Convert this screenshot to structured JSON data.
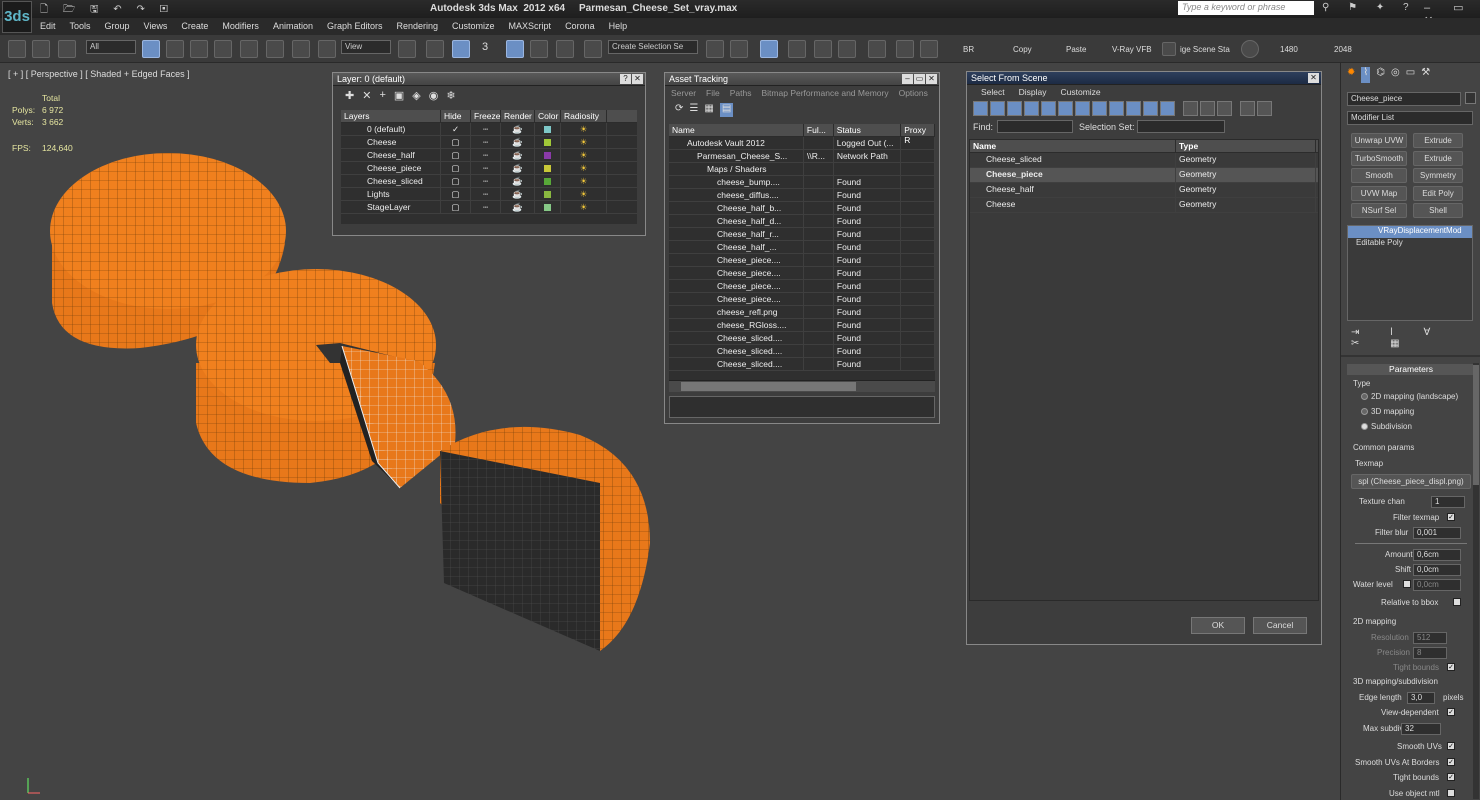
{
  "app": {
    "title": "Autodesk 3ds Max  2012 x64     Parmesan_Cheese_Set_vray.max",
    "logo": "3ds",
    "search_placeholder": "Type a keyword or phrase"
  },
  "menu": [
    "Edit",
    "Tools",
    "Group",
    "Views",
    "Create",
    "Modifiers",
    "Animation",
    "Graph Editors",
    "Rendering",
    "Customize",
    "MAXScript",
    "Corona",
    "Help"
  ],
  "toolbar": {
    "filter": "All",
    "view": "View",
    "selection_set": "Create Selection Se",
    "snap_3": "3",
    "labels": [
      "BR",
      "Copy",
      "Paste",
      "V-Ray VFB",
      "ige Scene Sta",
      "1480",
      "2048"
    ]
  },
  "viewport": {
    "label": "[ + ] [ Perspective ] [ Shaded + Edged Faces ]",
    "stats": {
      "total": "Total",
      "polys_label": "Polys:",
      "polys": "6 972",
      "verts_label": "Verts:",
      "verts": "3 662",
      "fps_label": "FPS:",
      "fps": "124,640"
    }
  },
  "layer_window": {
    "title": "Layer: 0 (default)",
    "columns": [
      "Layers",
      "Hide",
      "Freeze",
      "Render",
      "Color",
      "Radiosity"
    ],
    "rows": [
      {
        "name": "0 (default)",
        "color": "#7ec8c8"
      },
      {
        "name": "Cheese",
        "color": "#a0c838"
      },
      {
        "name": "Cheese_half",
        "color": "#8a3aa8"
      },
      {
        "name": "Cheese_piece",
        "color": "#c8c838"
      },
      {
        "name": "Cheese_sliced",
        "color": "#58a838"
      },
      {
        "name": "Lights",
        "color": "#8ab840"
      },
      {
        "name": "StageLayer",
        "color": "#86c886"
      }
    ]
  },
  "asset_window": {
    "title": "Asset Tracking",
    "menu": [
      "Server",
      "File",
      "Paths",
      "Bitmap Performance and Memory",
      "Options"
    ],
    "columns": [
      "Name",
      "Ful...",
      "Status",
      "Proxy R"
    ],
    "rows": [
      {
        "name": "Autodesk Vault 2012",
        "full": "",
        "status": "Logged Out (...",
        "indent": 1
      },
      {
        "name": "Parmesan_Cheese_S...",
        "full": "\\\\R...",
        "status": "Network Path",
        "indent": 2
      },
      {
        "name": "Maps / Shaders",
        "full": "",
        "status": "",
        "indent": 3
      },
      {
        "name": "cheese_bump....",
        "full": "",
        "status": "Found",
        "indent": 4
      },
      {
        "name": "cheese_diffus....",
        "full": "",
        "status": "Found",
        "indent": 4
      },
      {
        "name": "Cheese_half_b...",
        "full": "",
        "status": "Found",
        "indent": 4
      },
      {
        "name": "Cheese_half_d...",
        "full": "",
        "status": "Found",
        "indent": 4
      },
      {
        "name": "Cheese_half_r...",
        "full": "",
        "status": "Found",
        "indent": 4
      },
      {
        "name": "Cheese_half_...",
        "full": "",
        "status": "Found",
        "indent": 4
      },
      {
        "name": "Cheese_piece....",
        "full": "",
        "status": "Found",
        "indent": 4
      },
      {
        "name": "Cheese_piece....",
        "full": "",
        "status": "Found",
        "indent": 4
      },
      {
        "name": "Cheese_piece....",
        "full": "",
        "status": "Found",
        "indent": 4
      },
      {
        "name": "Cheese_piece....",
        "full": "",
        "status": "Found",
        "indent": 4
      },
      {
        "name": "cheese_refl.png",
        "full": "",
        "status": "Found",
        "indent": 4
      },
      {
        "name": "cheese_RGloss....",
        "full": "",
        "status": "Found",
        "indent": 4
      },
      {
        "name": "Cheese_sliced....",
        "full": "",
        "status": "Found",
        "indent": 4
      },
      {
        "name": "Cheese_sliced....",
        "full": "",
        "status": "Found",
        "indent": 4
      },
      {
        "name": "Cheese_sliced....",
        "full": "",
        "status": "Found",
        "indent": 4
      }
    ]
  },
  "select_window": {
    "title": "Select From Scene",
    "menu": [
      "Select",
      "Display",
      "Customize"
    ],
    "find_label": "Find:",
    "selset_label": "Selection Set:",
    "columns": [
      "Name",
      "Type"
    ],
    "rows": [
      {
        "name": "Cheese_sliced",
        "type": "Geometry",
        "selected": false
      },
      {
        "name": "Cheese_piece",
        "type": "Geometry",
        "selected": true
      },
      {
        "name": "Cheese_half",
        "type": "Geometry",
        "selected": false
      },
      {
        "name": "Cheese",
        "type": "Geometry",
        "selected": false
      }
    ],
    "ok": "OK",
    "cancel": "Cancel"
  },
  "command_panel": {
    "object_name": "Cheese_piece",
    "modifier_list": "Modifier List",
    "buttons": [
      "Unwrap UVW",
      "Extrude",
      "TurboSmooth",
      "Extrude",
      "Smooth",
      "Symmetry",
      "UVW Map",
      "Edit Poly",
      "NSurf Sel",
      "Shell"
    ],
    "stack": [
      "VRayDisplacementMod",
      "Editable Poly"
    ],
    "params": {
      "header": "Parameters",
      "type_label": "Type",
      "type_options": [
        "2D mapping (landscape)",
        "3D mapping",
        "Subdivision"
      ],
      "common_params": "Common params",
      "texmap_label": "Texmap",
      "texmap": "spl (Cheese_piece_displ.png)",
      "texture_chan_label": "Texture chan",
      "texture_chan": "1",
      "filter_texmap": "Filter texmap",
      "filter_blur_label": "Filter blur",
      "filter_blur": "0,001",
      "amount_label": "Amount",
      "amount": "0,6cm",
      "shift_label": "Shift",
      "shift": "0,0cm",
      "water_level_label": "Water level",
      "water_level": "0,0cm",
      "relative_bbox": "Relative to bbox",
      "mapping_2d": "2D mapping",
      "resolution_label": "Resolution",
      "resolution": "512",
      "precision_label": "Precision",
      "precision": "8",
      "tight_bounds": "Tight bounds",
      "mapping_3d": "3D mapping/subdivision",
      "edge_length_label": "Edge length",
      "edge_length": "3,0",
      "pixels": "pixels",
      "view_dependent": "View-dependent",
      "max_subdivs_label": "Max subdivs",
      "max_subdivs": "32",
      "smooth_uvs": "Smooth UVs",
      "smooth_uvs_borders": "Smooth UVs At Borders",
      "tight_bounds2": "Tight bounds",
      "use_object_mtl": "Use object mtl"
    }
  },
  "colors": {
    "cheese": "#e8781a",
    "selected_row": "#6b8fc4"
  }
}
